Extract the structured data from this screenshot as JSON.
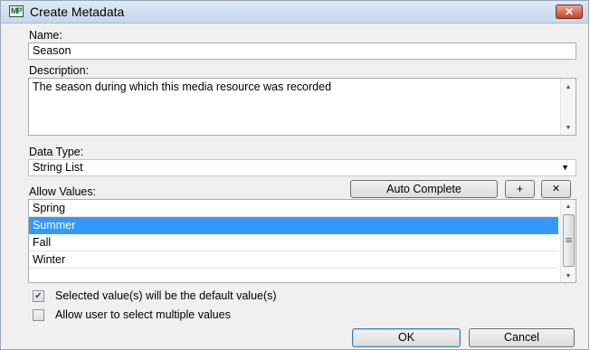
{
  "window": {
    "title": "Create Metadata",
    "close_glyph": "✕",
    "app_icon_label": "MP"
  },
  "name": {
    "label": "Name:",
    "value": "Season"
  },
  "description": {
    "label": "Description:",
    "value": "The season during which this media resource was recorded"
  },
  "data_type": {
    "label": "Data Type:",
    "selected": "String List"
  },
  "allow_values": {
    "label": "Allow Values:",
    "auto_complete_label": "Auto Complete",
    "add_label": "+",
    "remove_label": "✕",
    "items": [
      "Spring",
      "Summer",
      "Fall",
      "Winter"
    ],
    "selected_index": 1
  },
  "options": {
    "default_value": {
      "label": "Selected value(s) will be the default value(s)",
      "checked": true
    },
    "multiple_values": {
      "label": "Allow user to select multiple values",
      "checked": false
    }
  },
  "footer": {
    "ok_label": "OK",
    "cancel_label": "Cancel"
  },
  "colors": {
    "selection": "#3399ff",
    "titlebar": "#c5d7ec",
    "close": "#c5432c"
  }
}
